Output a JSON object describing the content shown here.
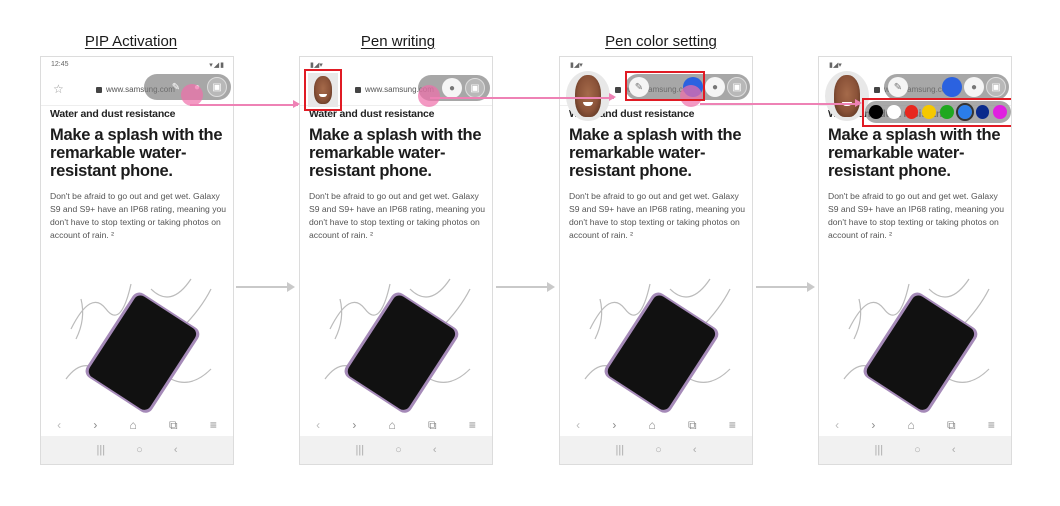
{
  "steps": [
    {
      "title": "PIP Activation",
      "status_time": "12:45"
    },
    {
      "title": "Pen writing",
      "status_time": ""
    },
    {
      "title": "Pen color setting",
      "status_time": ""
    },
    {
      "title": "",
      "status_time": ""
    }
  ],
  "page": {
    "url": "www.samsung.com",
    "subhead": "Water and dust resistance",
    "headline": "Make a splash with the remarkable water-resistant phone.",
    "body": "Don't be afraid to go out and get wet. Galaxy S9 and S9+ have an IP68 rating, meaning you don't have to stop texting or taking photos on account of rain. ²"
  },
  "browser_nav": {
    "back": "‹",
    "forward": "›",
    "home": "⌂",
    "tabs": "⧉",
    "menu": "≡"
  },
  "system_nav": {
    "recents": "|||",
    "home": "○",
    "back": "‹"
  },
  "pip_toolbar": {
    "pen": "✎",
    "contact": "●",
    "window": "▣"
  },
  "pen_colors": [
    {
      "name": "black",
      "hex": "#000000"
    },
    {
      "name": "white",
      "hex": "#ffffff"
    },
    {
      "name": "red",
      "hex": "#e8281e"
    },
    {
      "name": "yellow",
      "hex": "#f5c800"
    },
    {
      "name": "green",
      "hex": "#1fa81f"
    },
    {
      "name": "blue",
      "hex": "#2b7de9",
      "selected": true
    },
    {
      "name": "navy",
      "hex": "#0a2a8c"
    },
    {
      "name": "magenta",
      "hex": "#e020e0"
    }
  ],
  "colors": {
    "highlight_red": "#e01b24",
    "touch_pink": "#f06eaa",
    "flow_arrow": "#ee82b5",
    "current_pen_color": "#2b7de9"
  }
}
